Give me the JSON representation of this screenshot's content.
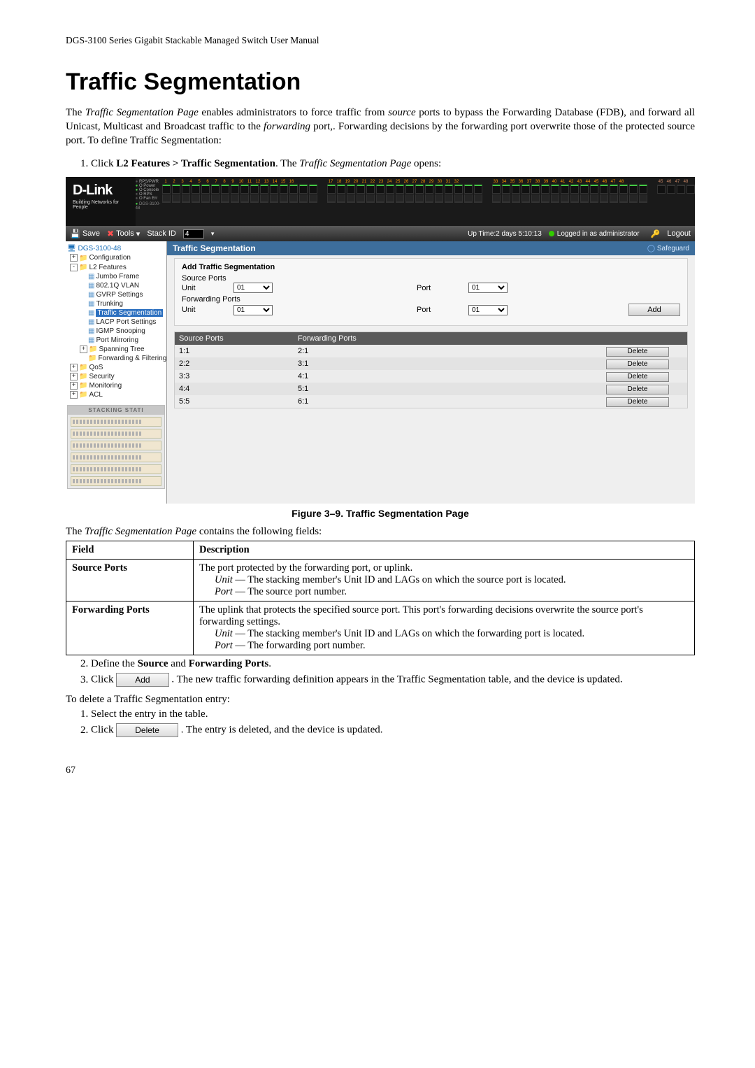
{
  "running_header": "DGS-3100 Series Gigabit Stackable Managed Switch User Manual",
  "title": "Traffic Segmentation",
  "intro_html": "The <i>Traffic Segmentation Page</i> enables administrators to force traffic from <i>source</i> ports to bypass the Forwarding Database (FDB), and forward all Unicast, Multicast and Broadcast traffic to the <i>forwarding</i> port,. Forwarding decisions by the forwarding port overwrite those of the protected source port. To define Traffic Segmentation:",
  "step1_html": "Click <b>L2 Features &gt; Traffic Segmentation</b>. The <i>Traffic Segmentation Page</i> opens:",
  "caption": "Figure 3–9. Traffic Segmentation Page",
  "desc_intro_html": "The <i>Traffic Segmentation Page</i> contains the following fields:",
  "table": {
    "headers": [
      "Field",
      "Description"
    ],
    "rows": [
      {
        "field": "Source Ports",
        "desc": [
          "The port protected by the forwarding port, or uplink.",
          "<i>Unit</i> — The stacking member's Unit ID and LAGs on which the source port is located.",
          "<i>Port</i> — The source port number."
        ]
      },
      {
        "field": "Forwarding Ports",
        "desc": [
          "The uplink that protects the specified source port. This port's forwarding decisions overwrite the source port's forwarding settings.",
          "<i>Unit</i> — The stacking member's Unit ID and LAGs on which the forwarding port is located.",
          "<i>Port</i> — The forwarding port number."
        ]
      }
    ]
  },
  "step2_html": "Define the <b>Source</b> and <b>Forwarding Ports</b>.",
  "step3_prefix": "Click ",
  "step3_btn": "Add",
  "step3_suffix": ". The new traffic forwarding definition appears in the Traffic Segmentation table, and the device is updated.",
  "to_delete": "To delete a Traffic Segmentation entry:",
  "del_step1": "Select the entry in the table.",
  "del_step2_prefix": "Click ",
  "del_step2_btn": "Delete",
  "del_step2_suffix": ". The entry is deleted, and the device is updated.",
  "page_number": "67",
  "screenshot": {
    "logo_brand": "D-Link",
    "logo_tagline": "Building Networks for People",
    "switch_leds": [
      "RPS/PWR",
      "O Power",
      "O Console",
      "O RPS",
      "O Fan Err"
    ],
    "switch_model": "DGS-3100-48",
    "toolbar": {
      "save": "Save",
      "tools": "Tools",
      "stackid_label": "Stack ID",
      "stackid_value": "4",
      "uptime": "Up Time:2 days 5:10:13",
      "logged_in": "Logged in as administrator",
      "logout": "Logout"
    },
    "tree": {
      "root": "DGS-3100-48",
      "items": [
        {
          "lvl": 1,
          "type": "folder",
          "pm": "+",
          "label": "Configuration"
        },
        {
          "lvl": 1,
          "type": "folder",
          "pm": "-",
          "label": "L2 Features"
        },
        {
          "lvl": 2,
          "type": "page",
          "label": "Jumbo Frame"
        },
        {
          "lvl": 2,
          "type": "page",
          "label": "802.1Q VLAN"
        },
        {
          "lvl": 2,
          "type": "page",
          "label": "GVRP Settings"
        },
        {
          "lvl": 2,
          "type": "page",
          "label": "Trunking"
        },
        {
          "lvl": 2,
          "type": "page",
          "label": "Traffic Segmentation",
          "selected": true
        },
        {
          "lvl": 2,
          "type": "page",
          "label": "LACP Port Settings"
        },
        {
          "lvl": 2,
          "type": "page",
          "label": "IGMP Snooping"
        },
        {
          "lvl": 2,
          "type": "page",
          "label": "Port Mirroring"
        },
        {
          "lvl": 2,
          "type": "folder",
          "pm": "+",
          "label": "Spanning Tree"
        },
        {
          "lvl": 2,
          "type": "folder",
          "label": "Forwarding & Filtering"
        },
        {
          "lvl": 1,
          "type": "folder",
          "pm": "+",
          "label": "QoS"
        },
        {
          "lvl": 1,
          "type": "folder",
          "pm": "+",
          "label": "Security"
        },
        {
          "lvl": 1,
          "type": "folder",
          "pm": "+",
          "label": "Monitoring"
        },
        {
          "lvl": 1,
          "type": "folder",
          "pm": "+",
          "label": "ACL"
        }
      ],
      "stack_title": "STACKING STATI",
      "stack_units": 6
    },
    "main": {
      "page_title": "Traffic Segmentation",
      "safeguard": "Safeguard",
      "add_title": "Add Traffic Segmentation",
      "source_ports_label": "Source Ports",
      "forwarding_ports_label": "Forwarding Ports",
      "unit_label": "Unit",
      "port_label": "Port",
      "unit_value": "01",
      "port_value": "01",
      "add_button": "Add",
      "seg_headers": [
        "Source Ports",
        "Forwarding Ports",
        ""
      ],
      "seg_rows": [
        {
          "source": "1:1",
          "forward": "2:1",
          "action": "Delete"
        },
        {
          "source": "2:2",
          "forward": "3:1",
          "action": "Delete"
        },
        {
          "source": "3:3",
          "forward": "4:1",
          "action": "Delete"
        },
        {
          "source": "4:4",
          "forward": "5:1",
          "action": "Delete"
        },
        {
          "source": "5:5",
          "forward": "6:1",
          "action": "Delete"
        }
      ]
    }
  }
}
